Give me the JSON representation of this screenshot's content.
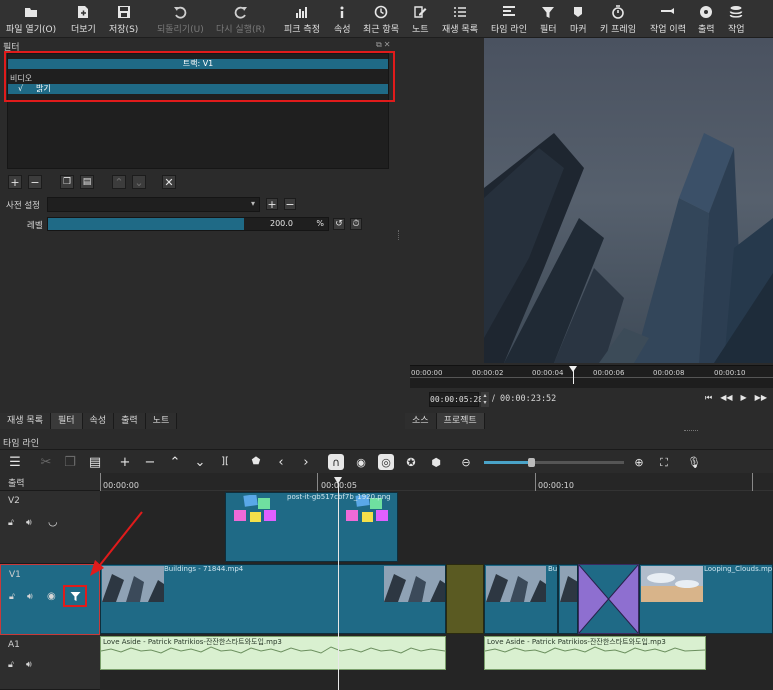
{
  "toolbar": {
    "items": [
      {
        "label": "파일 열기(O)",
        "icon": "open-folder-icon",
        "enabled": true
      },
      {
        "label": "더보기",
        "icon": "add-file-icon",
        "enabled": true
      },
      {
        "label": "저장(S)",
        "icon": "save-icon",
        "enabled": true
      },
      {
        "label": "되돌리기(U)",
        "icon": "undo-icon",
        "enabled": false
      },
      {
        "label": "다시 실행(R)",
        "icon": "redo-icon",
        "enabled": false
      },
      {
        "label": "피크 측정",
        "icon": "peak-meter-icon",
        "enabled": true
      },
      {
        "label": "속성",
        "icon": "info-icon",
        "enabled": true
      },
      {
        "label": "최근 항목",
        "icon": "clock-icon",
        "enabled": true
      },
      {
        "label": "노트",
        "icon": "notes-icon",
        "enabled": true
      },
      {
        "label": "재생 목록",
        "icon": "playlist-icon",
        "enabled": true
      },
      {
        "label": "타임 라인",
        "icon": "timeline-icon",
        "enabled": true
      },
      {
        "label": "필터",
        "icon": "filter-icon",
        "enabled": true
      },
      {
        "label": "마커",
        "icon": "marker-icon",
        "enabled": true
      },
      {
        "label": "키 프레임",
        "icon": "stopwatch-icon",
        "enabled": true
      },
      {
        "label": "작업 이력",
        "icon": "history-icon",
        "enabled": true
      },
      {
        "label": "출력",
        "icon": "export-icon",
        "enabled": true
      },
      {
        "label": "작업",
        "icon": "jobs-icon",
        "enabled": true
      }
    ]
  },
  "filters_panel": {
    "title": "필터",
    "track_header": "트랙: V1",
    "category": "비디오",
    "items": [
      {
        "check": "√",
        "label": "밝기"
      }
    ],
    "preset_label": "사전 설정",
    "preset_value": "",
    "param_label": "레벨",
    "param_value": "200.0",
    "param_unit": "%",
    "param_fraction": 0.7
  },
  "left_tabs": [
    "재생 목록",
    "필터",
    "속성",
    "출력",
    "노트"
  ],
  "player": {
    "ruler_labels": [
      "00:00:00",
      "00:00:02",
      "00:00:04",
      "00:00:06",
      "00:00:08",
      "00:00:10"
    ],
    "current_time": "00:00:05:28",
    "separator": "/",
    "total_time": "00:00:23:52",
    "tabs": [
      "소스",
      "프로젝트"
    ]
  },
  "timeline": {
    "title": "타임 라인",
    "ruler_labels": [
      "00:00:00",
      "00:00:05",
      "00:00:10"
    ],
    "output_label": "출력",
    "tracks": [
      {
        "name": "V2"
      },
      {
        "name": "V1"
      },
      {
        "name": "A1"
      }
    ],
    "clips": {
      "v2": "post-it-gb517cbf7b_1920.png",
      "v1a": "Buildings - 71844.mp4",
      "v1b": "Bu",
      "v1c": "Looping_Clouds.mp",
      "a1a": "Love Aside - Patrick Patrikios-잔잔한스타트와도입.mp3",
      "a1b": "Love Aside - Patrick Patrikios-잔잔한스타트와도입.mp3"
    }
  }
}
